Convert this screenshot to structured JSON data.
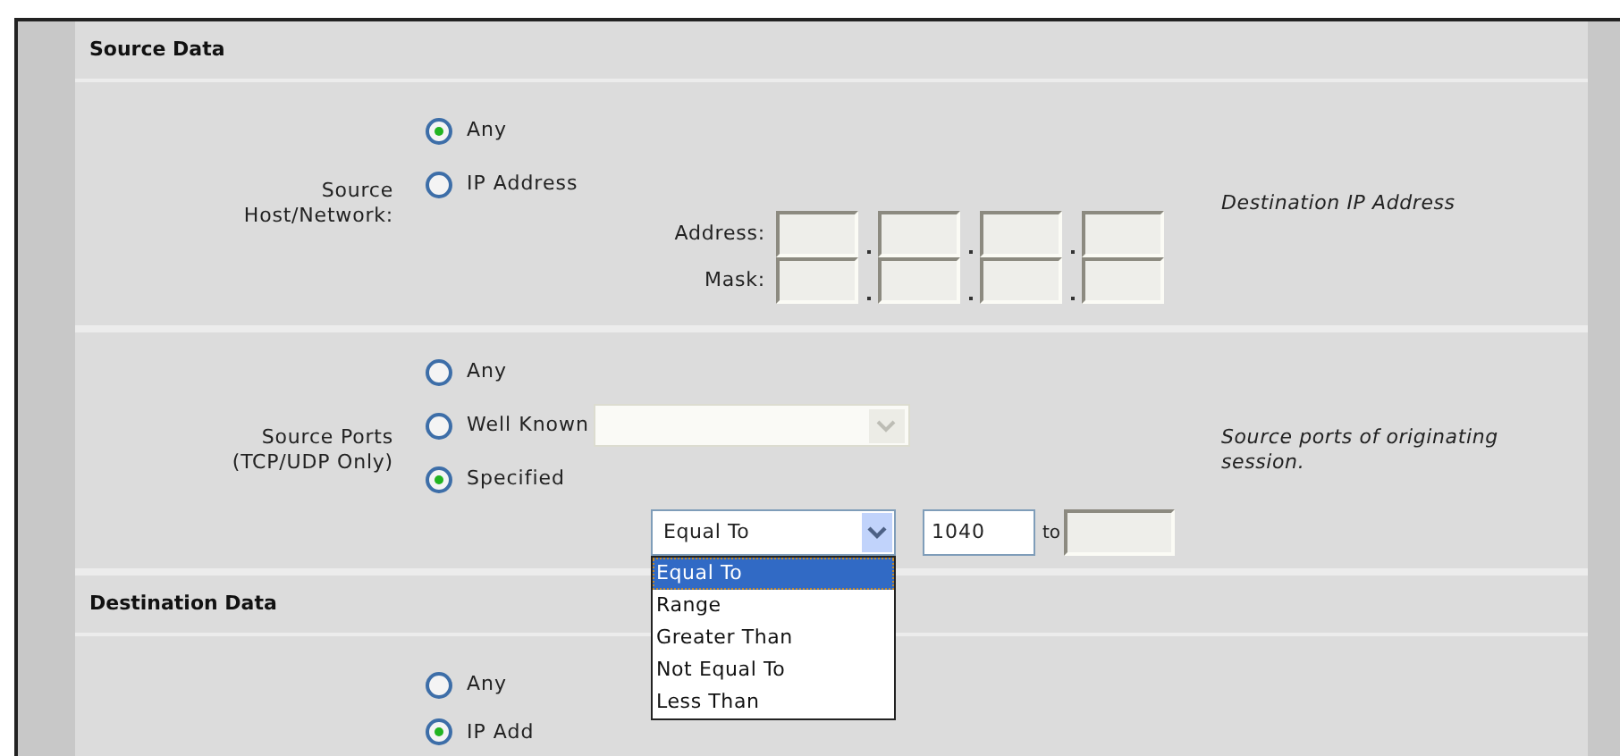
{
  "source_data": {
    "title": "Source Data",
    "host_network": {
      "label": "Source Host/Network:",
      "options": [
        {
          "label": "Any",
          "selected": true
        },
        {
          "label": "IP Address",
          "selected": false
        }
      ],
      "ip_fields": [
        {
          "label": "Address:"
        },
        {
          "label": "Mask:"
        }
      ],
      "description": "Destination IP Address"
    },
    "ports": {
      "label": "Source Ports (TCP/UDP Only)",
      "options": [
        {
          "label": "Any",
          "selected": false,
          "kind": "plain"
        },
        {
          "label": "Well Known",
          "selected": false,
          "kind": "select"
        },
        {
          "label": "Specified",
          "selected": true,
          "kind": "plain"
        }
      ],
      "operator": {
        "value": "Equal To",
        "expanded": true,
        "options": [
          {
            "label": "Equal To",
            "selected": true
          },
          {
            "label": "Range",
            "selected": false
          },
          {
            "label": "Greater Than",
            "selected": false
          },
          {
            "label": "Not Equal To",
            "selected": false
          },
          {
            "label": "Less Than",
            "selected": false
          }
        ]
      },
      "port_from": "1040",
      "to_label": "to",
      "description": "Source ports of originating session."
    }
  },
  "destination_data": {
    "title": "Destination Data",
    "options": [
      {
        "label": "Any",
        "selected": false
      },
      {
        "label": "IP Add",
        "selected": true
      }
    ]
  }
}
